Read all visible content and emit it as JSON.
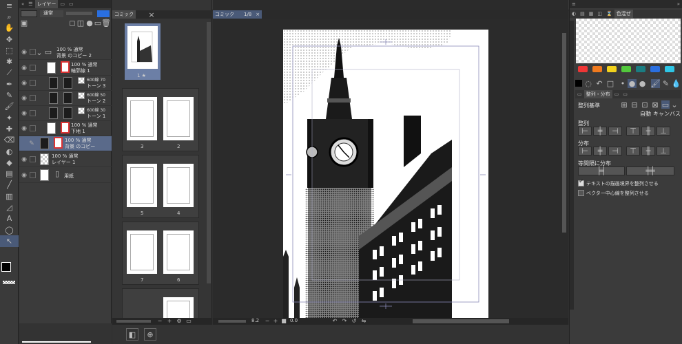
{
  "layers_panel": {
    "tab_label": "レイヤー",
    "blend_mode": "通常",
    "layers": [
      {
        "line1": "100 % 通常",
        "line2": "背景 のコピー 2"
      },
      {
        "line1": "100 % 通常",
        "line2": "輪郭線 1"
      },
      {
        "line1": "600線 70",
        "line2": "トーン 3"
      },
      {
        "line1": "600線 50",
        "line2": "トーン 2"
      },
      {
        "line1": "600線 30",
        "line2": "トーン 1"
      },
      {
        "line1": "100 % 通常",
        "line2": "下地 1"
      },
      {
        "line1": "100 % 通常",
        "line2": "背景 のコピー"
      },
      {
        "line1": "100 % 通常",
        "line2": "レイヤー 1"
      },
      {
        "line1": "用紙",
        "line2": ""
      }
    ]
  },
  "navigator": {
    "tab_label": "コミック",
    "cover_label": "1 ★",
    "page_numbers": [
      "3",
      "2",
      "5",
      "4",
      "7",
      "6"
    ]
  },
  "canvas": {
    "tab_label": "コミック",
    "tab_page": "1/8"
  },
  "status": {
    "zoom": "8.2",
    "angle": "0.0"
  },
  "right_panel": {
    "tab_label": "色混ぜ",
    "colors": [
      "#ef3636",
      "#f07a1e",
      "#f2d21c",
      "#52c83c",
      "#1a7d82",
      "#2a6fe0",
      "#2ec6e6"
    ],
    "align_tab": "整列・分布",
    "align_basis": "整列基準",
    "auto": "自動",
    "canvas": "キャンバス",
    "align": "整列",
    "distribute": "分布",
    "even_spacing": "等間隔に分布",
    "checkbox_text_bounds": "テキストの描画境界を整列させる",
    "checkbox_vector_center": "ベクター中心線を整列させる"
  }
}
